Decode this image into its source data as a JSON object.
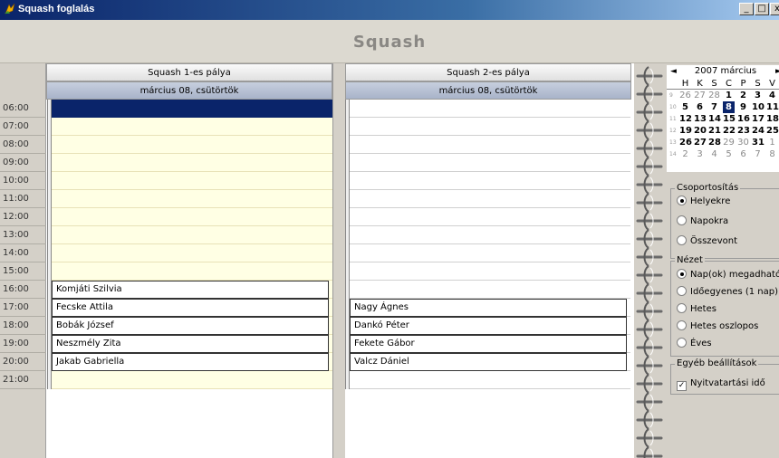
{
  "window": {
    "title": "Squash foglalás",
    "minimize": "_",
    "maximize": "□",
    "close": "x"
  },
  "banner": {
    "title": "Squash"
  },
  "schedule": {
    "hours": [
      "06:00",
      "07:00",
      "08:00",
      "09:00",
      "10:00",
      "11:00",
      "12:00",
      "13:00",
      "14:00",
      "15:00",
      "16:00",
      "17:00",
      "18:00",
      "19:00",
      "20:00",
      "21:00"
    ],
    "courts": [
      {
        "name": "Squash 1-es pálya",
        "date": "március 08, csütörtök"
      },
      {
        "name": "Squash 2-es pálya",
        "date": "március 08, csütörtök"
      }
    ],
    "bookings_court1": [
      {
        "time": "16:00",
        "name": "Komjáti Szilvia"
      },
      {
        "time": "17:00",
        "name": "Fecske Attila"
      },
      {
        "time": "18:00",
        "name": "Bobák József"
      },
      {
        "time": "19:00",
        "name": "Neszmély Zita"
      },
      {
        "time": "20:00",
        "name": "Jakab Gabriella"
      }
    ],
    "bookings_court2": [
      {
        "time": "17:00",
        "name": "Nagy Ágnes"
      },
      {
        "time": "18:00",
        "name": "Dankó Péter"
      },
      {
        "time": "19:00",
        "name": "Fekete Gábor"
      },
      {
        "time": "20:00",
        "name": "Valcz Dániel"
      }
    ]
  },
  "calendar": {
    "month_label": "2007 március",
    "prev": "◄",
    "next": "►",
    "dow": [
      "H",
      "K",
      "S",
      "C",
      "P",
      "S",
      "V"
    ],
    "weeks": [
      {
        "wk": "9",
        "days": [
          "26",
          "27",
          "28",
          "1",
          "2",
          "3",
          "4"
        ]
      },
      {
        "wk": "10",
        "days": [
          "5",
          "6",
          "7",
          "8",
          "9",
          "10",
          "11"
        ]
      },
      {
        "wk": "11",
        "days": [
          "12",
          "13",
          "14",
          "15",
          "16",
          "17",
          "18"
        ]
      },
      {
        "wk": "12",
        "days": [
          "19",
          "20",
          "21",
          "22",
          "23",
          "24",
          "25"
        ]
      },
      {
        "wk": "13",
        "days": [
          "26",
          "27",
          "28",
          "29",
          "30",
          "31",
          "1"
        ]
      },
      {
        "wk": "14",
        "days": [
          "2",
          "3",
          "4",
          "5",
          "6",
          "7",
          "8"
        ]
      }
    ],
    "selected_day": "8"
  },
  "grouping": {
    "label": "Csoportosítás",
    "options": [
      "Helyekre",
      "Napokra",
      "Összevont"
    ],
    "selected": "Helyekre"
  },
  "view": {
    "label": "Nézet",
    "options": [
      "Nap(ok) megadható",
      "Időegyenes (1 nap)",
      "Hetes",
      "Hetes oszlopos",
      "Éves"
    ],
    "selected": "Nap(ok) megadható"
  },
  "other": {
    "label": "Egyéb beállítások",
    "opening_hours_label": "Nyitvatartási idő",
    "opening_hours_checked": true
  },
  "colors": {
    "selection": "#0a246a",
    "slot_open": "#ffffe4",
    "title_gradient_start": "#0a246a"
  }
}
